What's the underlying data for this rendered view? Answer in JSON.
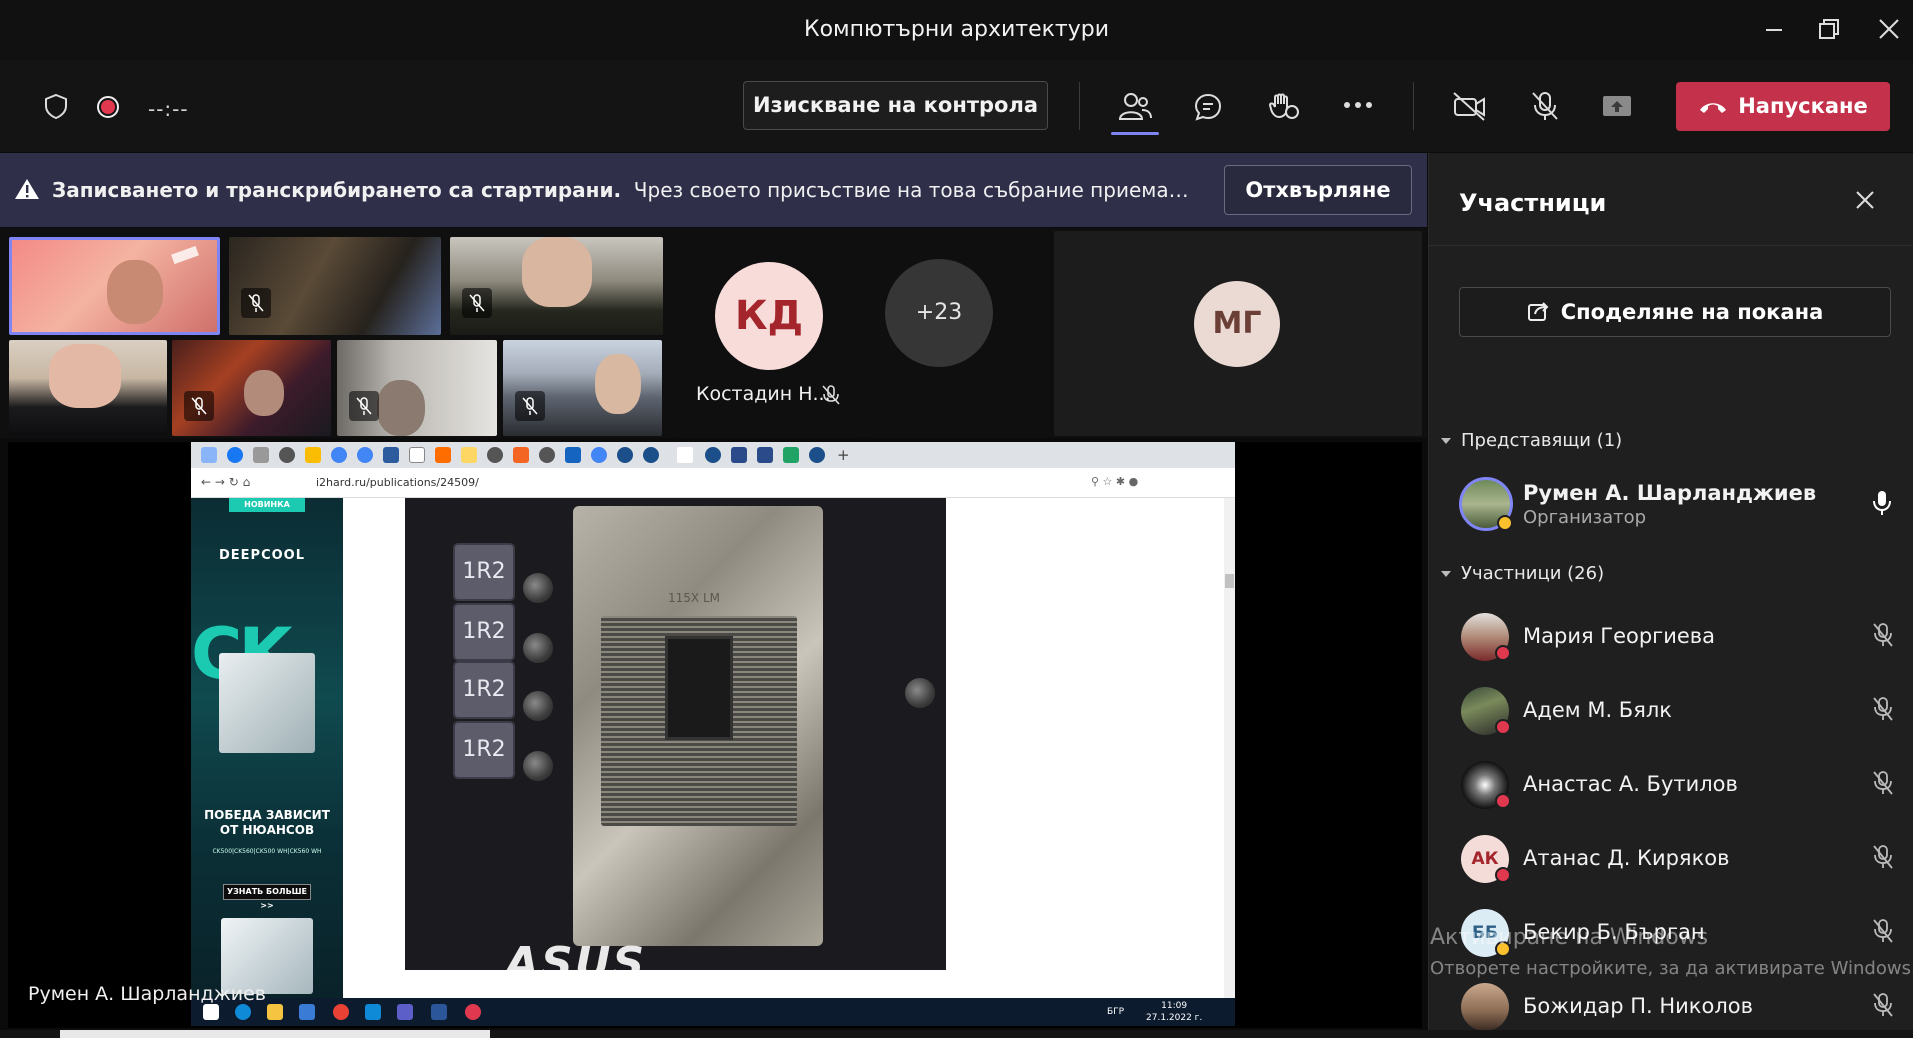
{
  "window": {
    "title": "Компютърни архитектури"
  },
  "toolbar": {
    "recording_timer": "--:--",
    "request_control_label": "Изискване на контрола",
    "leave_label": "Напускане",
    "icons": [
      "shield-icon",
      "record-icon",
      "people-icon",
      "chat-icon",
      "raise-hand-icon",
      "more-icon",
      "camera-off-icon",
      "mic-off-icon",
      "share-tray-icon"
    ],
    "accent": "#7f85f5",
    "leave_color": "#c4314b"
  },
  "banner": {
    "bold_text": "Записването и транскрибирането са стартирани.",
    "text": "Чрез своето присъствие на това събрание приемате да бъд...",
    "reject_label": "Отхвърляне",
    "background": "#2f2f4a"
  },
  "gallery": {
    "kd_initials": "КД",
    "kd_name": "Костадин Н...",
    "overflow_count": "+23",
    "mg_initials": "МГ"
  },
  "shared_screen": {
    "url": "i2hard.ru/publications/24509/",
    "ad_novinka": "НОВИНКА",
    "ad_brand": "DEEPCOOL",
    "ad_big": "CK",
    "ad_slogan": "ПОБЕДА ЗАВИСИТ ОТ НЮАНСОВ",
    "ad_models": "CK500|CK560|CK500 WH|CK560 WH",
    "ad_more": "УЗНАТЬ БОЛЬШЕ >>",
    "choke_label": "1R2",
    "board_brand": "ASUS",
    "socket_label": "115X LM",
    "taskbar_lang": "БГР",
    "taskbar_time": "11:09",
    "taskbar_date": "27.1.2022 г.",
    "presenter_name": "Румен А. Шарланджиев"
  },
  "panel": {
    "title": "Участници",
    "share_invite_label": "Споделяне на покана",
    "presenters_header": "Представящи (1)",
    "presenter": {
      "name": "Румен А. Шарланджиев",
      "role": "Организатор"
    },
    "participants_header": "Участници (26)",
    "participants": [
      {
        "name": "Мария Георгиева",
        "initials": ""
      },
      {
        "name": "Адем М. Бялк",
        "initials": ""
      },
      {
        "name": "Анастас А. Бутилов",
        "initials": ""
      },
      {
        "name": "Атанас Д. Киряков",
        "initials": "АК"
      },
      {
        "name": "Бекир Б. Бърган",
        "initials": "ББ"
      },
      {
        "name": "Божидар П. Николов",
        "initials": ""
      }
    ]
  },
  "watermark": {
    "line1": "Активиране на Windows",
    "line2": "Отворете настройките, за да активирате Windows."
  }
}
